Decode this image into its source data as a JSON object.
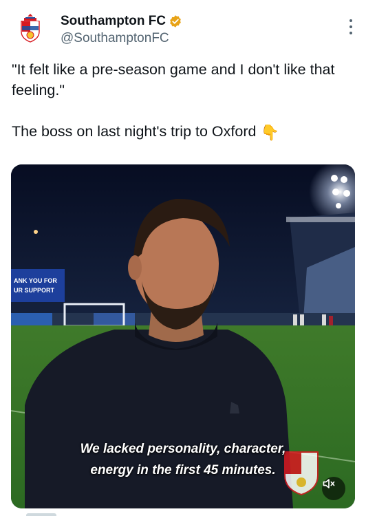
{
  "author": {
    "name": "Southampton FC",
    "handle": "@SouthamptonFC",
    "verified": true,
    "verified_badge_color": "#e8a317"
  },
  "post": {
    "line1": "\"It felt like a pre-season game and I don't like that feeling.\"",
    "line2": "The boss on last night's trip to Oxford",
    "emoji": "👇"
  },
  "media": {
    "type": "video",
    "caption_line1": "We lacked personality, character,",
    "caption_line2": "energy in the first 45 minutes.",
    "watermark": "Southampton FC crest",
    "mute_icon": "speaker-muted-icon"
  },
  "colors": {
    "text_primary": "#0f1419",
    "text_secondary": "#536471",
    "club_red": "#d71920"
  }
}
